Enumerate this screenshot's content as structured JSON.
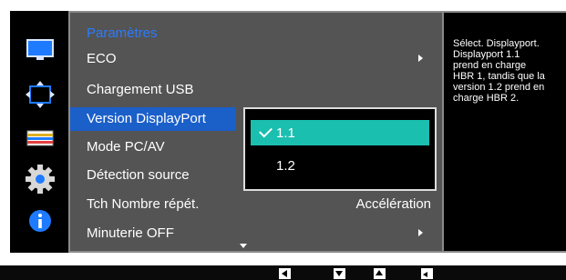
{
  "menu": {
    "title": "Paramètres",
    "items": [
      {
        "label": "ECO",
        "value": "",
        "has_arrow": true
      },
      {
        "label": "Chargement USB",
        "value": "",
        "has_arrow": false
      },
      {
        "label": "Version DisplayPort",
        "value": "",
        "has_arrow": false,
        "selected": true
      },
      {
        "label": "Mode PC/AV",
        "value": "",
        "has_arrow": false
      },
      {
        "label": "Détection source",
        "value": "",
        "has_arrow": false
      },
      {
        "label": "Tch Nombre répét.",
        "value": "Accélération",
        "has_arrow": false
      },
      {
        "label": "Minuterie OFF",
        "value": "",
        "has_arrow": true
      }
    ]
  },
  "submenu": {
    "options": [
      {
        "label": "1.1",
        "selected": true
      },
      {
        "label": "1.2",
        "selected": false
      }
    ]
  },
  "help": {
    "text": "Sélect. Displayport.\nDisplayport 1.1\nprend en charge\nHBR 1, tandis que la\nversion 1.2 prend en\ncharge HBR 2."
  },
  "icons": [
    "monitor-icon",
    "resize-icon",
    "color-bars-icon",
    "gear-icon",
    "info-icon"
  ],
  "colors": {
    "title": "#2a7bff",
    "selected_row": "#1b5fc9",
    "selected_option": "#1bbfb0",
    "menu_bg": "#545454"
  },
  "bottom_keys": [
    "left-key-icon",
    "down-key-icon",
    "up-key-icon",
    "enter-key-icon"
  ]
}
